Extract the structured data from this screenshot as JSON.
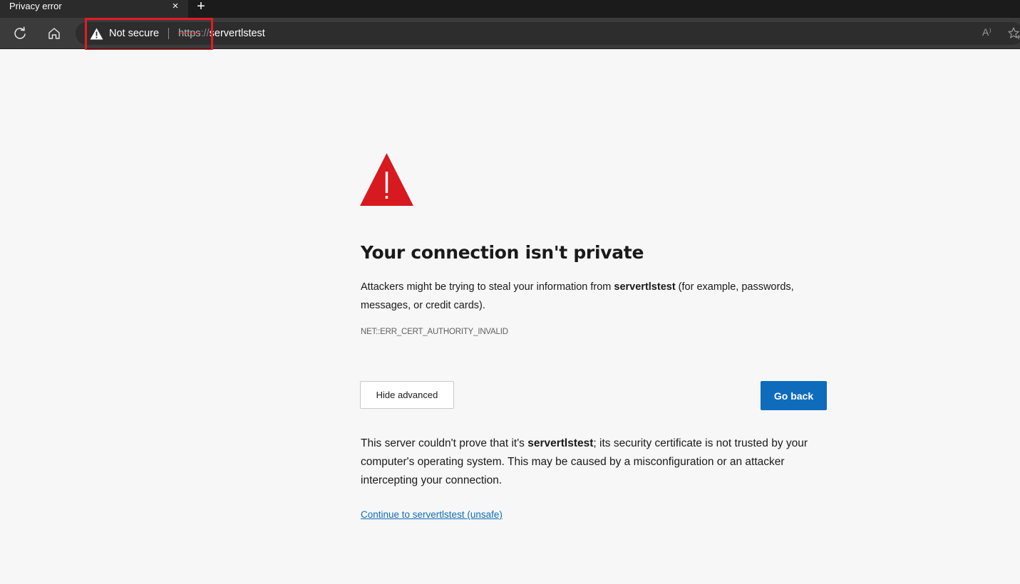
{
  "tab": {
    "title": "Privacy error",
    "close_glyph": "×",
    "new_tab_glyph": "+"
  },
  "toolbar": {
    "reload_icon": "reload-icon",
    "home_icon": "home-icon",
    "security_label": "Not secure",
    "url_scheme": "https",
    "url_separator": "://",
    "url_host": "servertlstest",
    "read_aloud_label": "A⁾",
    "favorites_icon": "favorites-add-icon"
  },
  "colors": {
    "error_red": "#d71920",
    "highlight_red": "#e21c24",
    "primary_blue": "#0f6cbd",
    "page_bg": "#f7f7f7"
  },
  "page": {
    "heading": "Your connection isn't private",
    "desc_prefix": "Attackers might be trying to steal your information from ",
    "desc_host": "servertlstest",
    "desc_suffix": " (for example, passwords, messages, or credit cards).",
    "error_code": "NET::ERR_CERT_AUTHORITY_INVALID",
    "hide_advanced_label": "Hide advanced",
    "go_back_label": "Go back",
    "details_prefix": "This server couldn't prove that it's ",
    "details_host": "servertlstest",
    "details_suffix": "; its security certificate is not trusted by your computer's operating system. This may be caused by a misconfiguration or an attacker intercepting your connection.",
    "continue_link": "Continue to servertlstest (unsafe)"
  }
}
